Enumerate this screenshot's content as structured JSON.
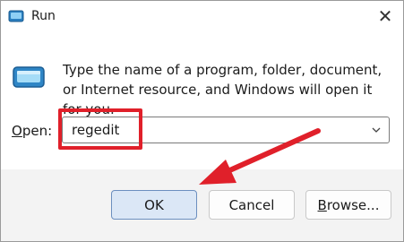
{
  "window": {
    "title": "Run",
    "icon": "run-icon",
    "close_icon": "close-icon"
  },
  "content": {
    "description": "Type the name of a program, folder, document, or Internet resource, and Windows will open it for you.",
    "open_label_accel": "O",
    "open_label_rest": "pen:",
    "open_value": "regedit"
  },
  "buttons": {
    "ok": "OK",
    "cancel": "Cancel",
    "browse_accel": "B",
    "browse_rest": "rowse..."
  },
  "annotation": {
    "highlight_color": "#e0202a",
    "arrow_color": "#e0202a"
  }
}
